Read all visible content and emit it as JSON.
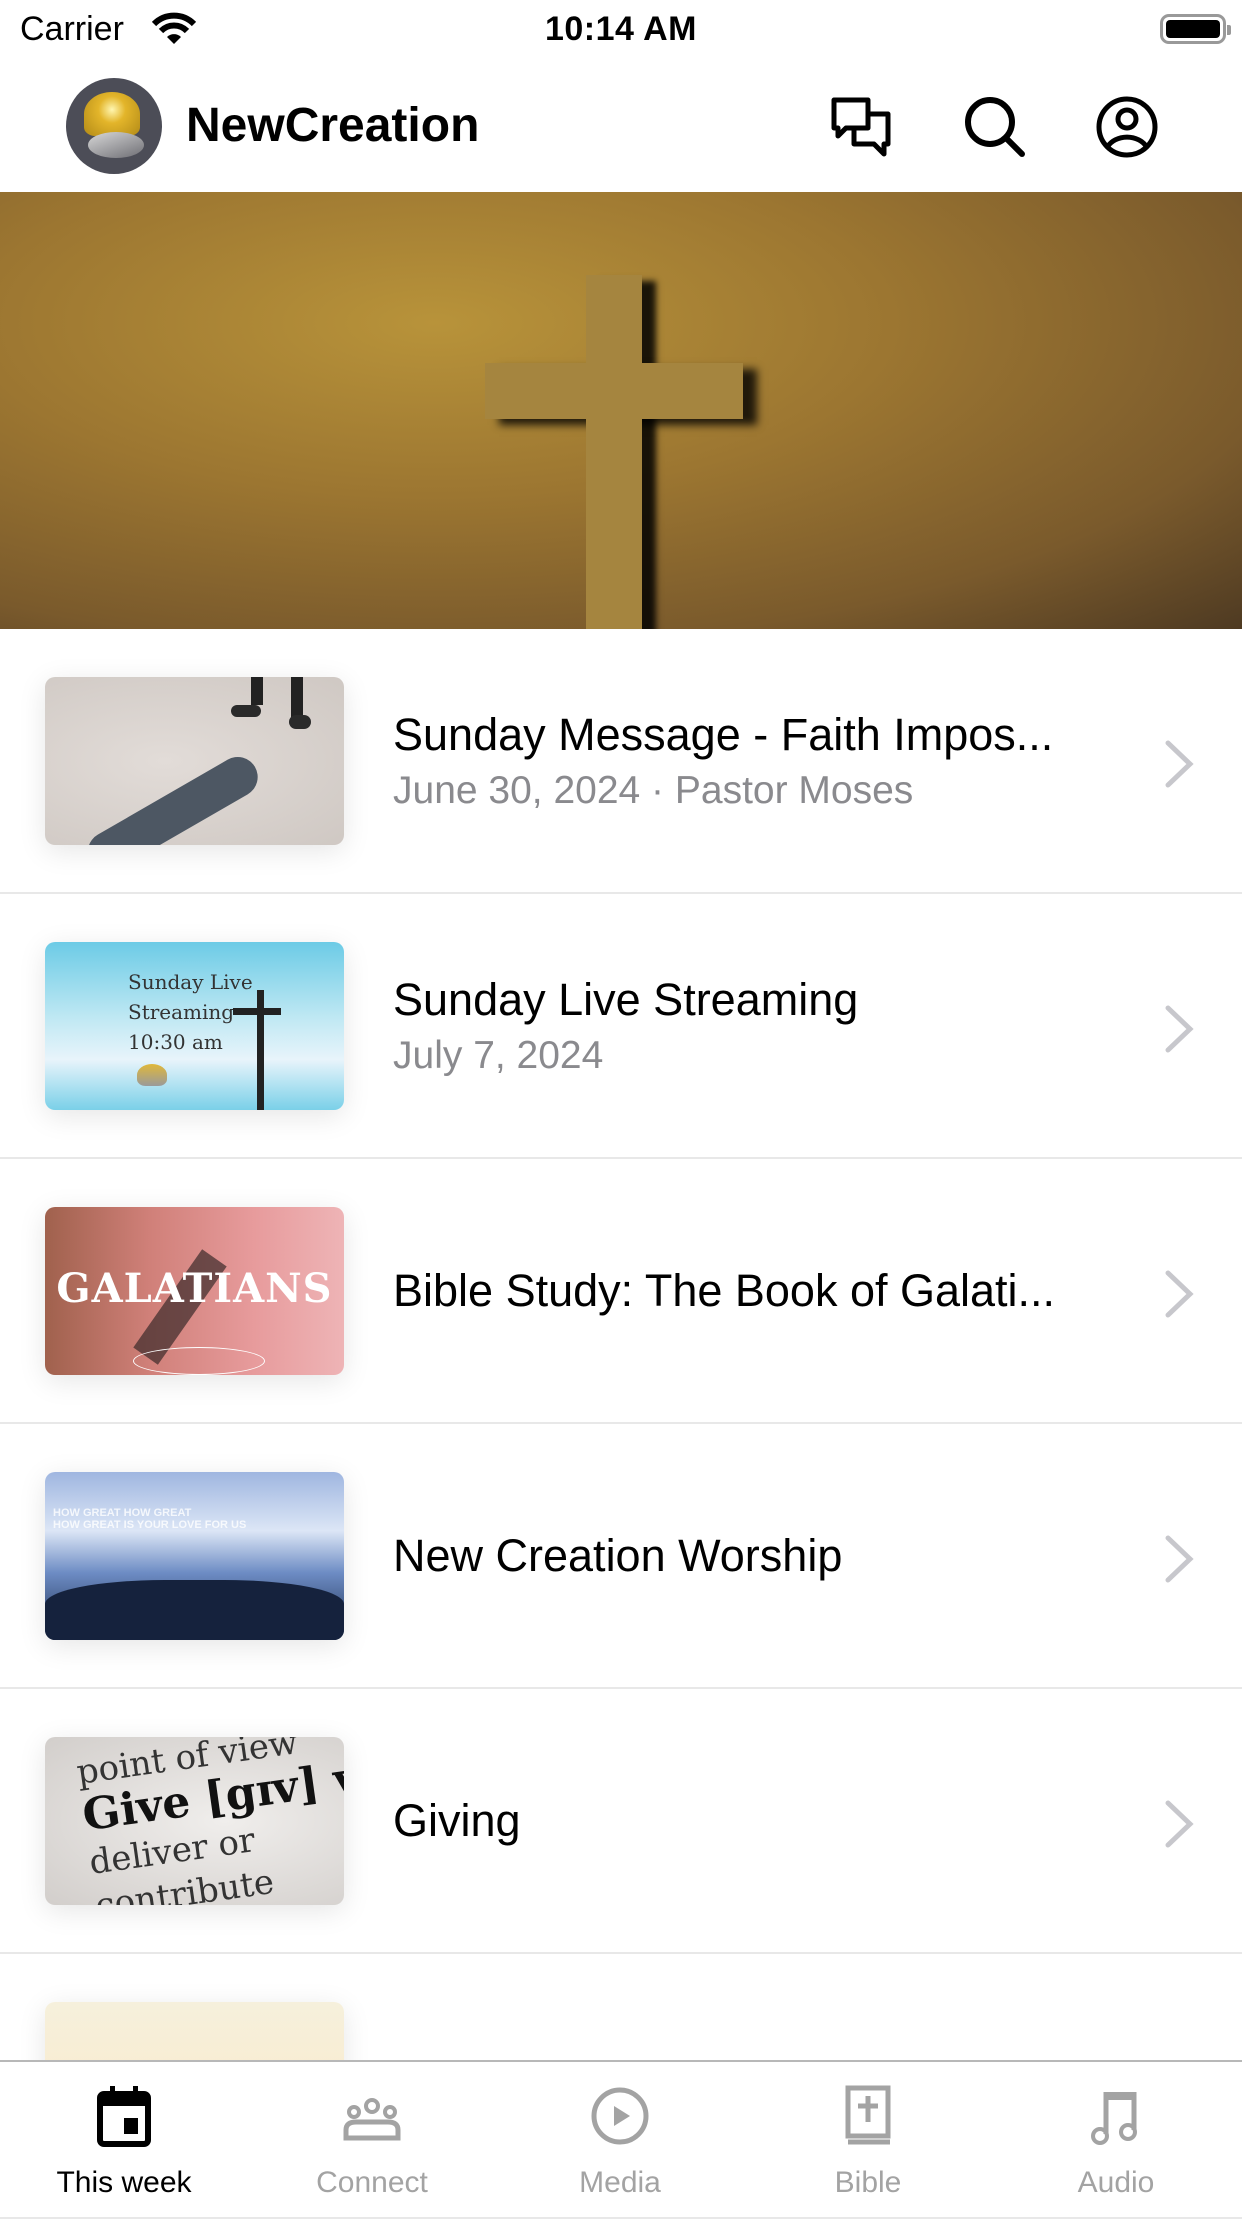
{
  "status_bar": {
    "carrier": "Carrier",
    "time": "10:14 AM",
    "wifi_icon": "wifi-icon",
    "battery_icon": "battery-icon"
  },
  "header": {
    "app_name": "NewCreation",
    "logo": "newcreation-logo",
    "actions": [
      {
        "name": "chat",
        "icon": "chat-bubbles-icon"
      },
      {
        "name": "search",
        "icon": "search-icon"
      },
      {
        "name": "profile",
        "icon": "user-circle-icon"
      }
    ]
  },
  "banner": {
    "image": "wooden-cross-banner"
  },
  "items": [
    {
      "title": "Sunday Message - Faith Impos...",
      "subtitle": "June 30, 2024 · Pastor Moses",
      "thumbnail": "shadow-on-sand"
    },
    {
      "title": "Sunday Live Streaming",
      "subtitle": "July 7, 2024",
      "thumbnail": "sky-cross",
      "thumb_text": [
        "Sunday Live",
        "Streaming",
        "10:30 am"
      ]
    },
    {
      "title": "Bible Study: The Book of Galati...",
      "subtitle": "",
      "thumbnail": "galatians",
      "thumb_text": [
        "GALATIANS"
      ]
    },
    {
      "title": "New Creation Worship",
      "subtitle": "",
      "thumbnail": "worship-crowd",
      "thumb_text": [
        "HOW GREAT HOW GREAT",
        "HOW GREAT IS YOUR LOVE FOR US"
      ]
    },
    {
      "title": "Giving",
      "subtitle": "",
      "thumbnail": "dictionary-give",
      "thumb_text": [
        "point of view",
        "Give [gɪv] v",
        "deliver or",
        "contribute"
      ]
    },
    {
      "title": "",
      "subtitle": "",
      "thumbnail": "partial-item"
    }
  ],
  "tabs": [
    {
      "label": "This week",
      "icon": "calendar-icon",
      "active": true
    },
    {
      "label": "Connect",
      "icon": "people-icon",
      "active": false
    },
    {
      "label": "Media",
      "icon": "play-circle-icon",
      "active": false
    },
    {
      "label": "Bible",
      "icon": "bible-icon",
      "active": false
    },
    {
      "label": "Audio",
      "icon": "music-note-icon",
      "active": false
    }
  ],
  "colors": {
    "active_tab": "#000000",
    "inactive_tab": "#a3a3a3",
    "subtitle": "#8a8a8e",
    "chevron": "#c7c7cc",
    "divider": "#e8e8e8"
  }
}
